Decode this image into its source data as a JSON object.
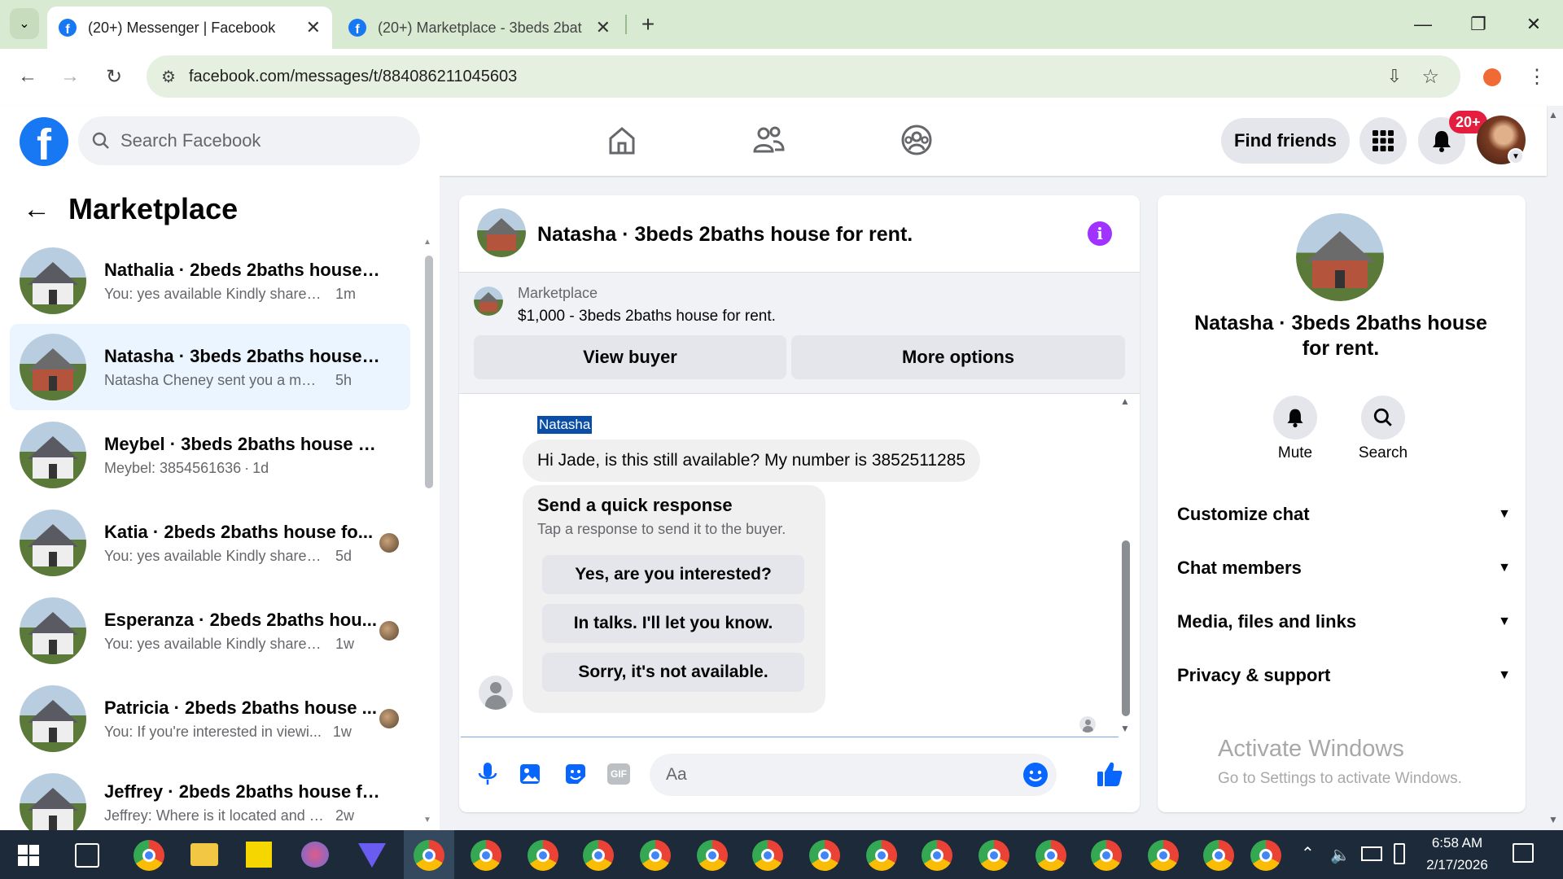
{
  "browser": {
    "tabs": [
      {
        "title": "(20+) Messenger | Facebook"
      },
      {
        "title": "(20+) Marketplace - 3beds 2bat"
      }
    ],
    "url": "facebook.com/messages/t/884086211045603",
    "new_tab": "+"
  },
  "fb": {
    "search_placeholder": "Search Facebook",
    "find_friends": "Find friends",
    "notif_badge": "20+"
  },
  "left": {
    "title": "Marketplace",
    "conversations": [
      {
        "title": "Nathalia · 2beds 2baths house f...",
        "snippet": "You: yes available Kindly share you...",
        "time": "1m"
      },
      {
        "title": "Natasha · 3beds 2baths house f...",
        "snippet": "Natasha Cheney sent you a messag...",
        "time": "5h"
      },
      {
        "title": "Meybel · 3beds 2baths house fo...",
        "snippet": "Meybel: 3854561636",
        "time": "1d"
      },
      {
        "title": "Katia · 2beds 2baths house fo...",
        "snippet": "You: yes available Kindly share y...",
        "time": "5d"
      },
      {
        "title": "Esperanza · 2beds 2baths hou...",
        "snippet": "You: yes available Kindly share y...",
        "time": "1w"
      },
      {
        "title": "Patricia · 2beds 2baths house ...",
        "snippet": "You: If you're interested in viewi...",
        "time": "1w"
      },
      {
        "title": "Jeffrey · 2beds 2baths house for...",
        "snippet": "Jeffrey: Where is it located and my ...",
        "time": "2w"
      }
    ]
  },
  "chat": {
    "header_title": "Natasha · 3beds 2baths house for rent.",
    "listing_label": "Marketplace",
    "listing_title": "$1,000 - 3beds 2baths house for rent.",
    "view_buyer": "View buyer",
    "more_options": "More options",
    "sender_name": "Natasha",
    "message": "Hi Jade, is this still available? My number is 3852511285",
    "quick_title": "Send a quick response",
    "quick_sub": "Tap a response to send it to the buyer.",
    "quick_responses": [
      "Yes, are you interested?",
      "In talks. I'll let you know.",
      "Sorry, it's not available."
    ],
    "composer_placeholder": "Aa",
    "gif_label": "GIF"
  },
  "info": {
    "name": "Natasha · 3beds 2baths house for rent.",
    "mute": "Mute",
    "search": "Search",
    "sections": [
      "Customize chat",
      "Chat members",
      "Media, files and links",
      "Privacy & support"
    ]
  },
  "watermark": {
    "title": "Activate Windows",
    "sub": "Go to Settings to activate Windows."
  },
  "taskbar": {
    "time": "6:58 AM",
    "date": "2/17/2026"
  },
  "colors": {
    "fb_blue": "#1877f2",
    "messenger_purple": "#a033ff",
    "selected_bg": "#ebf5ff",
    "tab_bar": "#d9ead3",
    "taskbar": "#1c2a3a"
  }
}
